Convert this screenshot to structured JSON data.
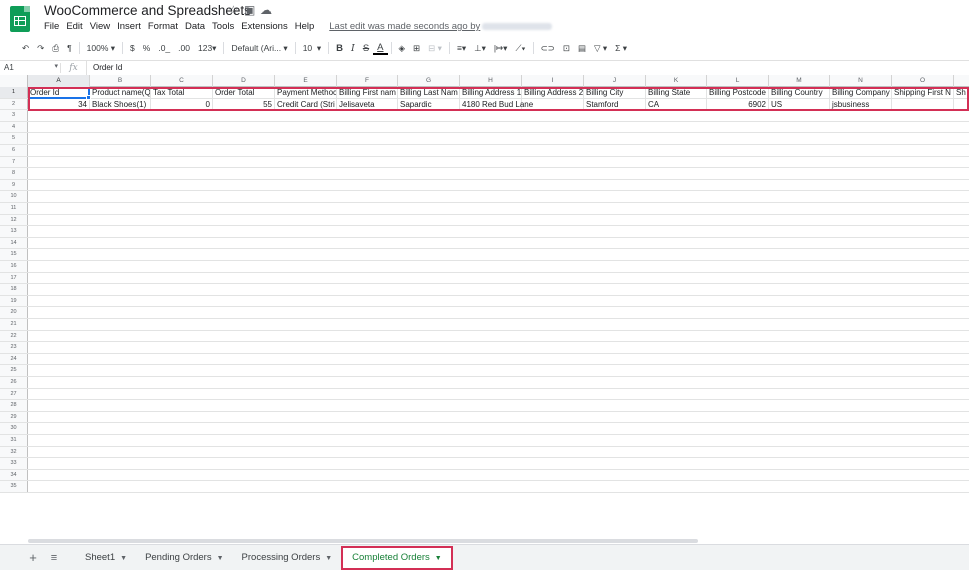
{
  "doc": {
    "title": "WooCommerce and Spreadsheets",
    "last_edit": "Last edit was made seconds ago by"
  },
  "menu": [
    "File",
    "Edit",
    "View",
    "Insert",
    "Format",
    "Data",
    "Tools",
    "Extensions",
    "Help"
  ],
  "toolbar": {
    "zoom": "100%",
    "currency": "$",
    "percent": "%",
    "dec_decrease": ".0_",
    "dec_increase": ".00",
    "more_formats": "123",
    "font": "Default (Ari...",
    "font_size": "10"
  },
  "formula_bar": {
    "cell_ref": "A1",
    "fx": "fx",
    "content": "Order Id"
  },
  "columns": [
    "A",
    "B",
    "C",
    "D",
    "E",
    "F",
    "G",
    "H",
    "I",
    "J",
    "K",
    "L",
    "M",
    "N",
    "O"
  ],
  "rows": [
    [
      "Order Id",
      "Product name(Q",
      "Tax Total",
      "Order Total",
      "Payment Methoc",
      "Billing First nam",
      "Billing Last Nam",
      "Billing Address 1",
      "Billing Address 2",
      "Billing City",
      "Billing State",
      "Billing Postcode",
      "Billing Country",
      "Billing Company",
      "Shipping First N",
      "Sh"
    ],
    [
      "34",
      "Black Shoes(1)",
      "0",
      "55",
      "Credit Card (Stri",
      "Jelisaveta",
      "Sapardic",
      "4180 Red Bud Lane",
      "",
      "Stamford",
      "CA",
      "6902",
      "US",
      "jsbusiness",
      "",
      ""
    ]
  ],
  "row_count": 35,
  "sheets": [
    {
      "label": "Sheet1"
    },
    {
      "label": "Pending Orders"
    },
    {
      "label": "Processing Orders"
    },
    {
      "label": "Completed Orders",
      "active": true
    }
  ],
  "colors": {
    "accent": "#1a73e8",
    "highlight": "#d32f55",
    "sheets_green": "#0f9d58",
    "active_tab_text": "#188038"
  }
}
